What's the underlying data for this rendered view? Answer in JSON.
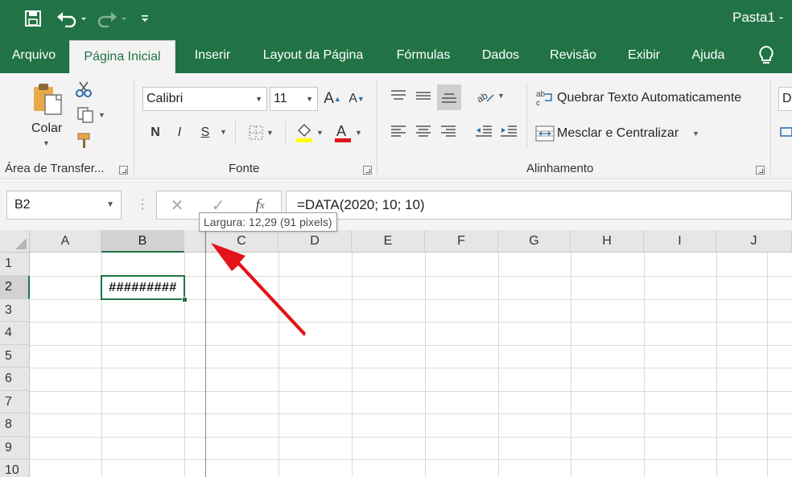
{
  "window": {
    "title": "Pasta1  -"
  },
  "quick_access": {
    "save_icon": "save-icon",
    "undo_icon": "undo-icon",
    "redo_icon": "redo-icon",
    "customize_icon": "customize-qat-icon"
  },
  "tabs": [
    {
      "label": "Arquivo"
    },
    {
      "label": "Página Inicial",
      "active": true
    },
    {
      "label": "Inserir"
    },
    {
      "label": "Layout da Página"
    },
    {
      "label": "Fórmulas"
    },
    {
      "label": "Dados"
    },
    {
      "label": "Revisão"
    },
    {
      "label": "Exibir"
    },
    {
      "label": "Ajuda"
    }
  ],
  "ribbon": {
    "clipboard": {
      "paste_label": "Colar",
      "group_label": "Área de Transfer..."
    },
    "font": {
      "font_name": "Calibri",
      "font_size": "11",
      "bold": "N",
      "italic": "I",
      "underline": "S",
      "group_label": "Fonte"
    },
    "alignment": {
      "wrap_text": "Quebrar Texto Automaticamente",
      "merge_center": "Mesclar e Centralizar",
      "group_label": "Alinhamento"
    },
    "number": {
      "format_partial": "D"
    }
  },
  "formula_bar": {
    "name_box": "B2",
    "formula": "=DATA(2020; 10; 10)"
  },
  "grid": {
    "columns": [
      "A",
      "B",
      "C",
      "D",
      "E",
      "F",
      "G",
      "H",
      "I",
      "J"
    ],
    "rows": [
      "1",
      "2",
      "3",
      "4",
      "5",
      "6",
      "7",
      "8",
      "9",
      "10"
    ],
    "selected_column": "B",
    "selected_row": "2",
    "active_cell": {
      "ref": "B2",
      "display": "#########"
    }
  },
  "tooltip": {
    "text": "Largura: 12,29 (91 pixels)"
  },
  "colors": {
    "excel_green": "#217346",
    "annotation_arrow": "#e3141a",
    "font_color_bar": "#e3141a",
    "fill_color_bar": "#ffff00"
  }
}
